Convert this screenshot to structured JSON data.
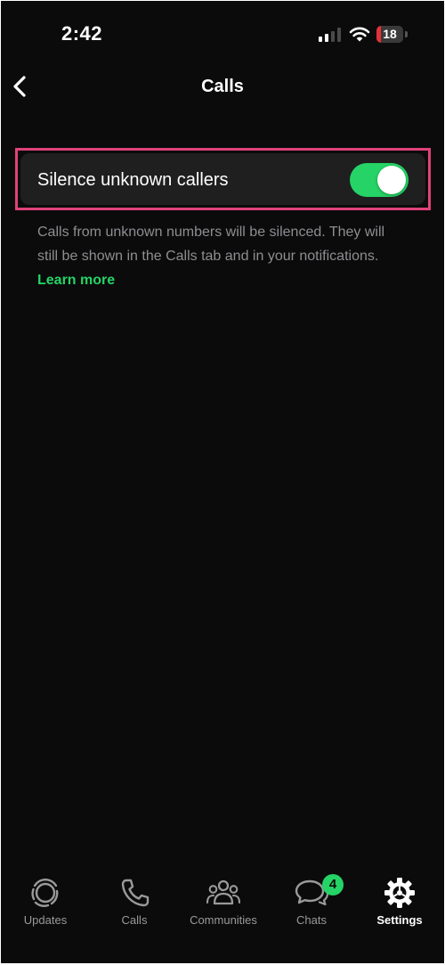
{
  "colors": {
    "background": "#0b0b0b",
    "row_background": "#1f1f1f",
    "accent_green": "#25d366",
    "highlight_pink": "#e0427a",
    "battery_red": "#e5313a",
    "secondary_text": "#8e8e93"
  },
  "status_bar": {
    "time": "2:42",
    "battery_level": "18",
    "battery_fraction": 0.18,
    "signal_bars_active": 2
  },
  "nav": {
    "back_icon": "chevron-left-icon",
    "title": "Calls"
  },
  "setting": {
    "label": "Silence unknown callers",
    "toggle_on": true,
    "description": "Calls from unknown numbers will be silenced. They will still be shown in the Calls tab and in your notifications.",
    "learn_more": "Learn more"
  },
  "tabs": [
    {
      "label": "Updates",
      "icon": "updates-icon",
      "active": false
    },
    {
      "label": "Calls",
      "icon": "phone-icon",
      "active": false
    },
    {
      "label": "Communities",
      "icon": "communities-icon",
      "active": false
    },
    {
      "label": "Chats",
      "icon": "chat-bubbles-icon",
      "active": false,
      "badge": "4"
    },
    {
      "label": "Settings",
      "icon": "gear-icon",
      "active": true
    }
  ]
}
